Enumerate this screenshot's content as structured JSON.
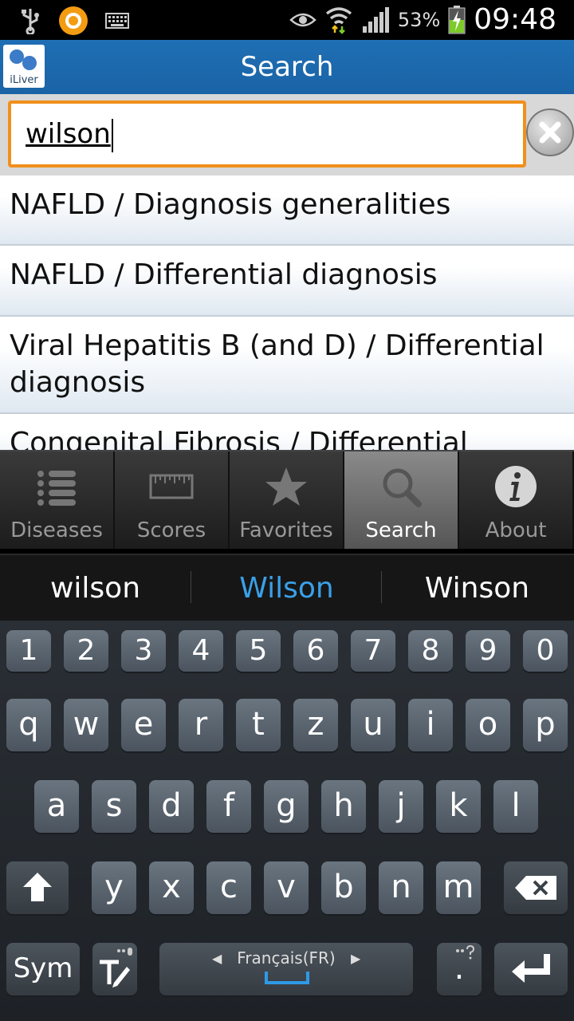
{
  "status": {
    "battery_pct": "53%",
    "clock": "09:48"
  },
  "header": {
    "app_name": "iLiver",
    "title": "Search"
  },
  "search": {
    "value": "wilson"
  },
  "results": [
    {
      "label": "NAFLD / Diagnosis generalities"
    },
    {
      "label": "NAFLD / Differential diagnosis"
    },
    {
      "label": "Viral Hepatitis B (and D) / Differential diagnosis"
    },
    {
      "label": "Congenital Fibrosis / Differential"
    }
  ],
  "tabs": [
    {
      "label": "Diseases",
      "icon": "list-icon"
    },
    {
      "label": "Scores",
      "icon": "ruler-icon"
    },
    {
      "label": "Favorites",
      "icon": "star-icon"
    },
    {
      "label": "Search",
      "icon": "magnifier-icon",
      "active": true
    },
    {
      "label": "About",
      "icon": "info-icon"
    }
  ],
  "suggestions": [
    "wilson",
    "Wilson",
    "Winson"
  ],
  "keyboard": {
    "row_numbers": [
      "1",
      "2",
      "3",
      "4",
      "5",
      "6",
      "7",
      "8",
      "9",
      "0"
    ],
    "row1": [
      "q",
      "w",
      "e",
      "r",
      "t",
      "z",
      "u",
      "i",
      "o",
      "p"
    ],
    "row2": [
      "a",
      "s",
      "d",
      "f",
      "g",
      "h",
      "j",
      "k",
      "l"
    ],
    "row3": [
      "y",
      "x",
      "c",
      "v",
      "b",
      "n",
      "m"
    ],
    "sym_label": "Sym",
    "language": "Français(FR)",
    "period": "."
  },
  "colors": {
    "action_bar": "#1f6fb4",
    "search_border": "#f0901c",
    "suggestion_highlight": "#3aa0e8"
  }
}
